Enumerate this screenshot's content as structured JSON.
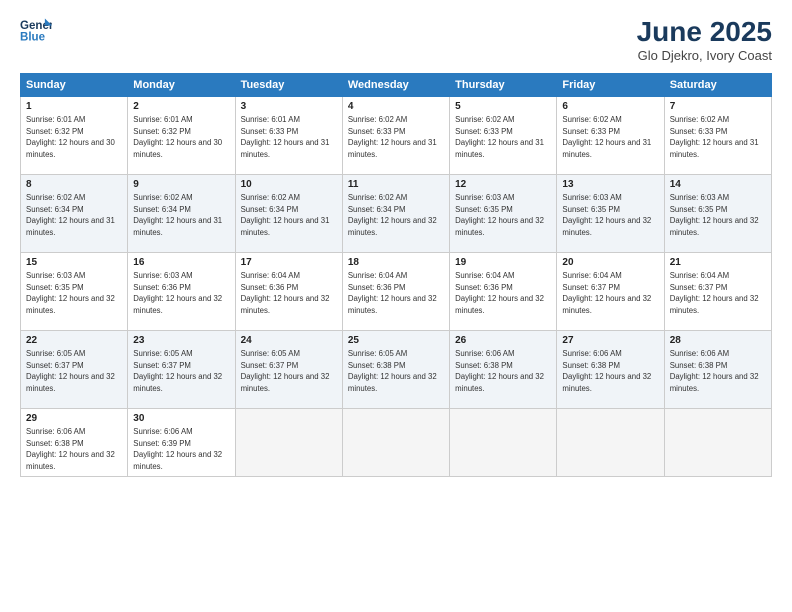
{
  "header": {
    "logo_line1": "General",
    "logo_line2": "Blue",
    "month": "June 2025",
    "location": "Glo Djekro, Ivory Coast"
  },
  "weekdays": [
    "Sunday",
    "Monday",
    "Tuesday",
    "Wednesday",
    "Thursday",
    "Friday",
    "Saturday"
  ],
  "weeks": [
    [
      {
        "day": "1",
        "rise": "6:01 AM",
        "set": "6:32 PM",
        "hours": "12 hours and 30 minutes."
      },
      {
        "day": "2",
        "rise": "6:01 AM",
        "set": "6:32 PM",
        "hours": "12 hours and 30 minutes."
      },
      {
        "day": "3",
        "rise": "6:01 AM",
        "set": "6:33 PM",
        "hours": "12 hours and 31 minutes."
      },
      {
        "day": "4",
        "rise": "6:02 AM",
        "set": "6:33 PM",
        "hours": "12 hours and 31 minutes."
      },
      {
        "day": "5",
        "rise": "6:02 AM",
        "set": "6:33 PM",
        "hours": "12 hours and 31 minutes."
      },
      {
        "day": "6",
        "rise": "6:02 AM",
        "set": "6:33 PM",
        "hours": "12 hours and 31 minutes."
      },
      {
        "day": "7",
        "rise": "6:02 AM",
        "set": "6:33 PM",
        "hours": "12 hours and 31 minutes."
      }
    ],
    [
      {
        "day": "8",
        "rise": "6:02 AM",
        "set": "6:34 PM",
        "hours": "12 hours and 31 minutes."
      },
      {
        "day": "9",
        "rise": "6:02 AM",
        "set": "6:34 PM",
        "hours": "12 hours and 31 minutes."
      },
      {
        "day": "10",
        "rise": "6:02 AM",
        "set": "6:34 PM",
        "hours": "12 hours and 31 minutes."
      },
      {
        "day": "11",
        "rise": "6:02 AM",
        "set": "6:34 PM",
        "hours": "12 hours and 32 minutes."
      },
      {
        "day": "12",
        "rise": "6:03 AM",
        "set": "6:35 PM",
        "hours": "12 hours and 32 minutes."
      },
      {
        "day": "13",
        "rise": "6:03 AM",
        "set": "6:35 PM",
        "hours": "12 hours and 32 minutes."
      },
      {
        "day": "14",
        "rise": "6:03 AM",
        "set": "6:35 PM",
        "hours": "12 hours and 32 minutes."
      }
    ],
    [
      {
        "day": "15",
        "rise": "6:03 AM",
        "set": "6:35 PM",
        "hours": "12 hours and 32 minutes."
      },
      {
        "day": "16",
        "rise": "6:03 AM",
        "set": "6:36 PM",
        "hours": "12 hours and 32 minutes."
      },
      {
        "day": "17",
        "rise": "6:04 AM",
        "set": "6:36 PM",
        "hours": "12 hours and 32 minutes."
      },
      {
        "day": "18",
        "rise": "6:04 AM",
        "set": "6:36 PM",
        "hours": "12 hours and 32 minutes."
      },
      {
        "day": "19",
        "rise": "6:04 AM",
        "set": "6:36 PM",
        "hours": "12 hours and 32 minutes."
      },
      {
        "day": "20",
        "rise": "6:04 AM",
        "set": "6:37 PM",
        "hours": "12 hours and 32 minutes."
      },
      {
        "day": "21",
        "rise": "6:04 AM",
        "set": "6:37 PM",
        "hours": "12 hours and 32 minutes."
      }
    ],
    [
      {
        "day": "22",
        "rise": "6:05 AM",
        "set": "6:37 PM",
        "hours": "12 hours and 32 minutes."
      },
      {
        "day": "23",
        "rise": "6:05 AM",
        "set": "6:37 PM",
        "hours": "12 hours and 32 minutes."
      },
      {
        "day": "24",
        "rise": "6:05 AM",
        "set": "6:37 PM",
        "hours": "12 hours and 32 minutes."
      },
      {
        "day": "25",
        "rise": "6:05 AM",
        "set": "6:38 PM",
        "hours": "12 hours and 32 minutes."
      },
      {
        "day": "26",
        "rise": "6:06 AM",
        "set": "6:38 PM",
        "hours": "12 hours and 32 minutes."
      },
      {
        "day": "27",
        "rise": "6:06 AM",
        "set": "6:38 PM",
        "hours": "12 hours and 32 minutes."
      },
      {
        "day": "28",
        "rise": "6:06 AM",
        "set": "6:38 PM",
        "hours": "12 hours and 32 minutes."
      }
    ],
    [
      {
        "day": "29",
        "rise": "6:06 AM",
        "set": "6:38 PM",
        "hours": "12 hours and 32 minutes."
      },
      {
        "day": "30",
        "rise": "6:06 AM",
        "set": "6:39 PM",
        "hours": "12 hours and 32 minutes."
      },
      null,
      null,
      null,
      null,
      null
    ]
  ]
}
